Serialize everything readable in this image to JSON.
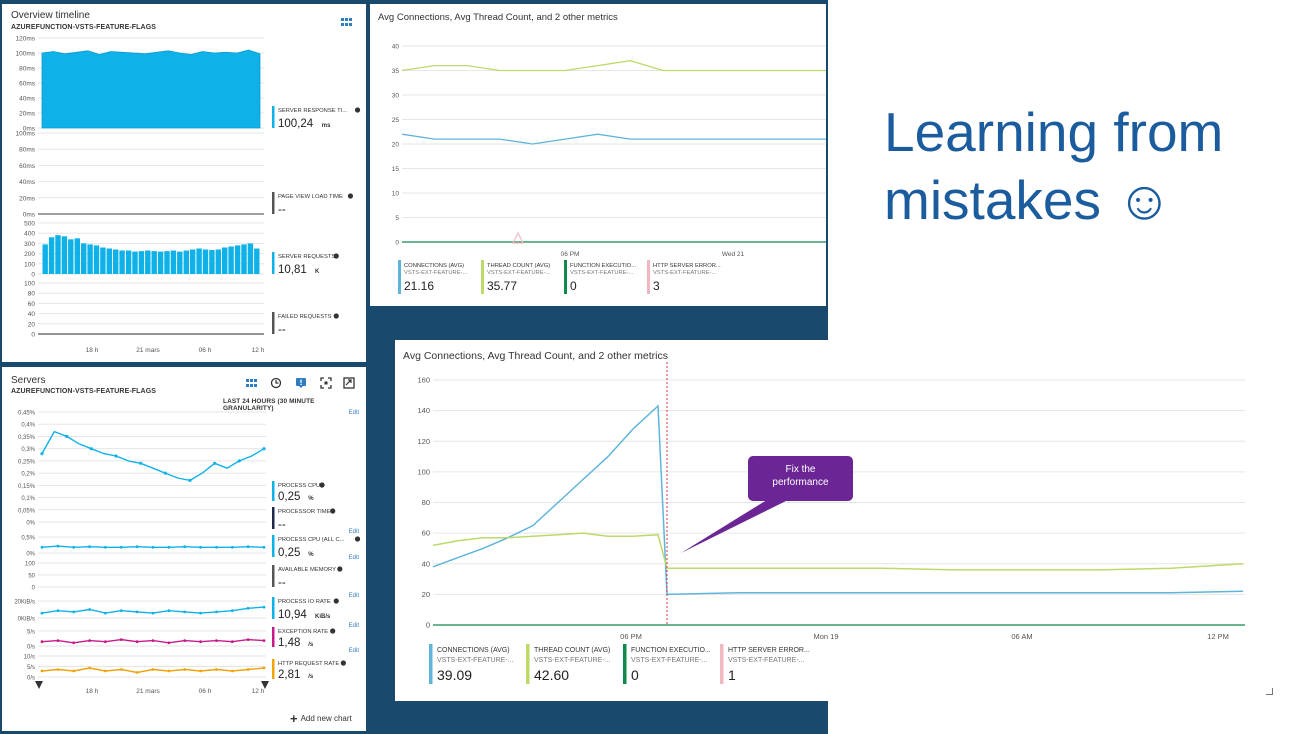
{
  "heading": {
    "line1": "Learning from",
    "line2": "mistakes ☺"
  },
  "overview": {
    "title": "Overview timeline",
    "subtitle": "AZUREFUNCTION-VSTS-FEATURE-FLAGS",
    "charts": [
      {
        "ticks": [
          "120ms",
          "100ms",
          "80ms",
          "60ms",
          "40ms",
          "20ms",
          "0ms"
        ],
        "metric": {
          "label": "SERVER RESPONSE TI...",
          "value": "100,24",
          "unit": "ms",
          "color": "#0fb2e8"
        }
      },
      {
        "ticks": [
          "100ms",
          "80ms",
          "60ms",
          "40ms",
          "20ms",
          "0ms"
        ],
        "metric": {
          "label": "PAGE VIEW LOAD TIME",
          "value": "--",
          "unit": "",
          "color": "#555555"
        }
      },
      {
        "ticks": [
          "500",
          "400",
          "300",
          "200",
          "100",
          "0"
        ],
        "metric": {
          "label": "SERVER REQUESTS",
          "value": "10,81",
          "unit": "K",
          "color": "#0fb2e8"
        }
      },
      {
        "ticks": [
          "100",
          "80",
          "60",
          "40",
          "20",
          "0"
        ],
        "metric": {
          "label": "FAILED REQUESTS",
          "value": "--",
          "unit": "",
          "color": "#555555"
        }
      }
    ],
    "x_ticks": [
      "18 h",
      "21 mars",
      "06 h",
      "12 h"
    ]
  },
  "servers": {
    "title": "Servers",
    "subtitle": "AZUREFUNCTION-VSTS-FEATURE-FLAGS",
    "granularity": "LAST 24 HOURS (30 MINUTE GRANULARITY)",
    "edit": "Edit",
    "add_chart": "Add new chart",
    "icons": [
      "grid-icon",
      "history-icon",
      "alert-icon",
      "expand-icon",
      "export-icon"
    ],
    "cpu_ticks": [
      "0,45%",
      "0,4%",
      "0,35%",
      "0,3%",
      "0,25%",
      "0,2%",
      "0,15%",
      "0,1%",
      "0,05%",
      "0%"
    ],
    "metrics": [
      {
        "label": "PROCESS CPU",
        "value": "0,25",
        "unit": "%",
        "color": "#0fb2e8"
      },
      {
        "label": "PROCESSOR TIME",
        "value": "--",
        "unit": "",
        "color": "#1e2a4a"
      },
      {
        "label": "PROCESS CPU (ALL C...",
        "value": "0,25",
        "unit": "%",
        "color": "#0fb2e8"
      },
      {
        "label": "AVAILABLE MEMORY",
        "value": "--",
        "unit": "",
        "color": "#555555"
      },
      {
        "label": "PROCESS IO RATE",
        "value": "10,94",
        "unit": "KiB/s",
        "color": "#0fb2e8"
      },
      {
        "label": "EXCEPTION RATE",
        "value": "1,48",
        "unit": "/s",
        "color": "#c8198a"
      },
      {
        "label": "HTTP REQUEST RATE",
        "value": "2,81",
        "unit": "/s",
        "color": "#f0a30a"
      }
    ],
    "small_ticks": {
      "cpu_all": [
        "0,5%",
        "0%"
      ],
      "memory": [
        "100",
        "50",
        "0"
      ],
      "io": [
        "20KiB/s",
        "0KiB/s"
      ],
      "exception": [
        "5/s",
        "0/s"
      ],
      "http": [
        "10/s",
        "5/s",
        "0/s"
      ]
    },
    "x_ticks": [
      "18 h",
      "21 mars",
      "06 h",
      "12 h"
    ]
  },
  "top_metrics": {
    "title": "Avg Connections, Avg Thread Count, and 2 other metrics",
    "y_ticks": [
      "40",
      "35",
      "30",
      "25",
      "20",
      "15",
      "10",
      "5",
      "0"
    ],
    "x_ticks": [
      "06 PM",
      "Wed 21"
    ],
    "legend": [
      {
        "label": "CONNECTIONS (AVG)",
        "sub": "VSTS-EXT-FEATURE-...",
        "value": "21.16",
        "color": "#5fb4dc"
      },
      {
        "label": "THREAD COUNT (AVG)",
        "sub": "VSTS-EXT-FEATURE-...",
        "value": "35.77",
        "color": "#bcd96a"
      },
      {
        "label": "FUNCTION EXECUTIO...",
        "sub": "VSTS-EXT-FEATURE-...",
        "value": "0",
        "color": "#0f8a4a"
      },
      {
        "label": "HTTP SERVER ERROR...",
        "sub": "VSTS-EXT-FEATURE-...",
        "value": "3",
        "color": "#f2b8c2"
      }
    ]
  },
  "bottom_metrics": {
    "title": "Avg Connections, Avg Thread Count, and 2 other metrics",
    "y_ticks": [
      "160",
      "140",
      "120",
      "100",
      "80",
      "60",
      "40",
      "20",
      "0"
    ],
    "x_ticks": [
      "06 PM",
      "Mon 19",
      "06 AM",
      "12 PM"
    ],
    "callout": {
      "line1": "Fix the",
      "line2": "performance",
      "color": "#6b2594"
    },
    "legend": [
      {
        "label": "CONNECTIONS (AVG)",
        "sub": "VSTS-EXT-FEATURE-...",
        "value": "39.09",
        "color": "#5fb4dc"
      },
      {
        "label": "THREAD COUNT (AVG)",
        "sub": "VSTS-EXT-FEATURE-...",
        "value": "42.60",
        "color": "#bcd96a"
      },
      {
        "label": "FUNCTION EXECUTIO...",
        "sub": "VSTS-EXT-FEATURE-...",
        "value": "0",
        "color": "#0f8a4a"
      },
      {
        "label": "HTTP SERVER ERROR...",
        "sub": "VSTS-EXT-FEATURE-...",
        "value": "1",
        "color": "#f2b8c2"
      }
    ]
  },
  "chart_data": [
    {
      "type": "line",
      "title": "Avg Connections, Avg Thread Count, and 2 other metrics",
      "x": [
        "",
        "06 PM",
        "",
        "Wed 21",
        ""
      ],
      "ylim": [
        0,
        40
      ],
      "series": [
        {
          "name": "CONNECTIONS (AVG)",
          "values": [
            22,
            21,
            21,
            21,
            20,
            21,
            22,
            21,
            21,
            21,
            21,
            21,
            21,
            21
          ]
        },
        {
          "name": "THREAD COUNT (AVG)",
          "values": [
            35,
            36,
            36,
            35,
            35,
            35,
            36,
            37,
            35,
            35,
            35,
            35,
            35,
            35
          ]
        },
        {
          "name": "FUNCTION EXECUTIO...",
          "values": [
            0,
            0,
            0,
            0,
            0,
            0,
            0,
            0,
            0,
            0,
            0,
            0,
            0,
            0
          ]
        }
      ]
    },
    {
      "type": "line",
      "title": "Avg Connections, Avg Thread Count, and 2 other metrics",
      "x": [
        "",
        "06 PM",
        "Mon 19",
        "06 AM",
        "12 PM"
      ],
      "ylim": [
        0,
        160
      ],
      "series": [
        {
          "name": "CONNECTIONS (AVG)",
          "values": [
            38,
            44,
            50,
            57,
            65,
            80,
            95,
            110,
            128,
            143,
            20,
            21,
            21,
            21,
            21,
            21,
            21,
            21,
            22
          ]
        },
        {
          "name": "THREAD COUNT (AVG)",
          "values": [
            52,
            55,
            57,
            57,
            58,
            59,
            60,
            58,
            58,
            59,
            37,
            37,
            37,
            37,
            36,
            36,
            36,
            37,
            40
          ]
        },
        {
          "name": "FUNCTION EXECUTIO...",
          "values": [
            0,
            0,
            0,
            0,
            0,
            0,
            0,
            0,
            0,
            0,
            0,
            0,
            0,
            0,
            0,
            0,
            0,
            0,
            0
          ]
        }
      ]
    },
    {
      "type": "area",
      "title": "",
      "ylim": [
        0,
        120
      ],
      "series": [
        {
          "name": "SERVER RESPONSE TI...",
          "values": [
            100,
            102,
            99,
            101,
            103,
            98,
            102,
            101,
            100,
            99,
            101,
            103,
            100,
            98,
            102,
            100,
            101,
            100,
            104,
            99
          ]
        }
      ]
    },
    {
      "type": "bar",
      "title": "",
      "ylim": [
        0,
        500
      ],
      "series": [
        {
          "name": "SERVER REQUESTS",
          "values": [
            290,
            360,
            380,
            370,
            340,
            350,
            300,
            290,
            280,
            260,
            250,
            240,
            230,
            230,
            220,
            225,
            230,
            225,
            220,
            225,
            230,
            220,
            230,
            240,
            250,
            240,
            235,
            240,
            260,
            270,
            280,
            290,
            300,
            250
          ]
        }
      ]
    },
    {
      "type": "line",
      "title": "",
      "ylim": [
        0,
        0.45
      ],
      "series": [
        {
          "name": "PROCESS CPU",
          "values": [
            0.28,
            0.37,
            0.35,
            0.32,
            0.3,
            0.28,
            0.27,
            0.25,
            0.24,
            0.22,
            0.2,
            0.18,
            0.17,
            0.2,
            0.24,
            0.22,
            0.25,
            0.27,
            0.3
          ]
        }
      ]
    }
  ]
}
